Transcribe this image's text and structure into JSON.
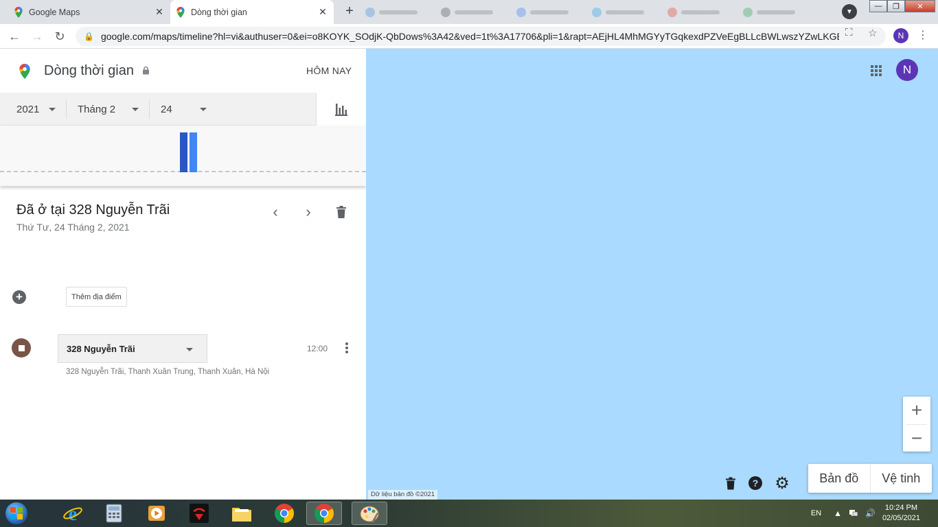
{
  "browser": {
    "tabs": [
      {
        "title": "Google Maps",
        "active": false
      },
      {
        "title": "Dòng thời gian",
        "active": true
      }
    ],
    "url": "google.com/maps/timeline?hl=vi&authuser=0&ei=o8KOYK_SOdjK-QbDows%3A42&ved=1t%3A17706&pli=1&rapt=AEjHL4MhMGYyTGqkexdPZVeEgBLLcBWLwszYZwLKGB...",
    "profile_initial": "N"
  },
  "header": {
    "title": "Dòng thời gian",
    "today_label": "HÔM NAY"
  },
  "date_selector": {
    "year": "2021",
    "month": "Tháng 2",
    "day": "24"
  },
  "histogram": {
    "bar_colors": [
      "#2a56c6",
      "#4285f4"
    ]
  },
  "visit": {
    "heading": "Đã ở tại 328 Nguyễn Trãi",
    "date": "Thứ Tư, 24 Tháng 2, 2021",
    "add_place_label": "Thêm địa điểm",
    "place_name": "328 Nguyễn Trãi",
    "time": "12:00",
    "address": "328 Nguyễn Trãi, Thanh Xuân Trung, Thanh Xuân, Hà Nội"
  },
  "map": {
    "water_color": "#aadaff",
    "avatar_initial": "N",
    "type_map": "Bản đồ",
    "type_satellite": "Vệ tinh",
    "attribution": "Dữ liệu bản đồ ©2021"
  },
  "taskbar": {
    "language": "EN",
    "time": "10:24 PM",
    "date": "02/05/2021"
  },
  "colors": {
    "accent": "#4285f4",
    "avatar": "#5c35b5",
    "stop_marker": "#795548"
  }
}
